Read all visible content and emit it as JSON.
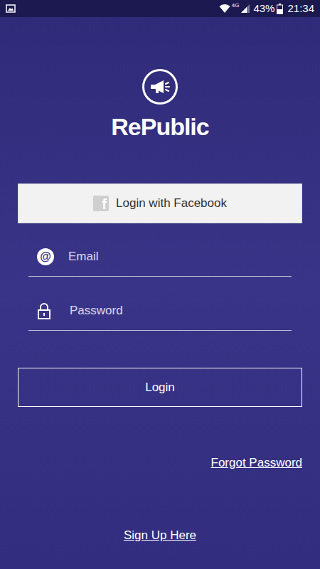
{
  "status_bar": {
    "network": "4G",
    "battery": "43%",
    "time": "21:34"
  },
  "logo": {
    "text": "RePublic"
  },
  "facebook_button": {
    "icon": "f",
    "label": "Login with Facebook"
  },
  "email": {
    "icon": "@",
    "placeholder": "Email"
  },
  "password": {
    "placeholder": "Password"
  },
  "login_button": {
    "label": "Login"
  },
  "forgot_password": "Forgot Password",
  "sign_up": "Sign Up Here"
}
